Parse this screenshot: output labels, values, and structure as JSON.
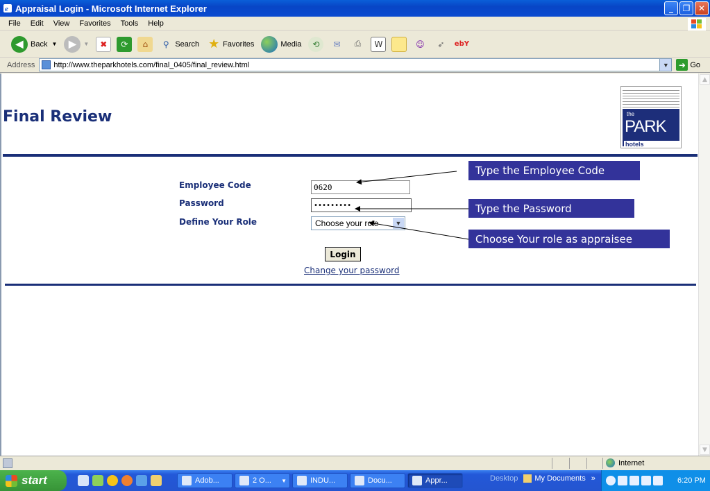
{
  "window": {
    "title": "Appraisal Login - Microsoft Internet Explorer",
    "buttons": [
      "_",
      "❐",
      "✕"
    ]
  },
  "menu": [
    "File",
    "Edit",
    "View",
    "Favorites",
    "Tools",
    "Help"
  ],
  "toolbar": {
    "back": "Back",
    "search": "Search",
    "favorites": "Favorites",
    "media": "Media"
  },
  "address": {
    "label": "Address",
    "url": "http://www.theparkhotels.com/final_0405/final_review.html",
    "go": "Go"
  },
  "page": {
    "title": "Final Review",
    "logo": {
      "the": "the",
      "park": "PARK",
      "hotels": "hotels"
    },
    "form": {
      "employee_code_label": "Employee Code",
      "employee_code_value": "0620",
      "password_label": "Password",
      "password_value": "•••••••••",
      "role_label": "Define Your Role",
      "role_value": "Choose your role",
      "login": "Login",
      "change_password": "Change your password "
    },
    "callouts": {
      "employee": "Type the Employee Code",
      "password": "Type the Password",
      "role": "Choose Your role as appraisee"
    }
  },
  "status": {
    "zone": "Internet"
  },
  "taskbar": {
    "start": "start",
    "tasks": [
      "Adob...",
      "2 O...",
      "INDU...",
      "Docu...",
      "Appr..."
    ],
    "desktop": "Desktop",
    "my_documents": "My Documents",
    "clock": "6:20 PM"
  },
  "colors": {
    "heading": "#1a2f78",
    "callout_bg": "#33339a",
    "rule": "#1a2f78"
  }
}
